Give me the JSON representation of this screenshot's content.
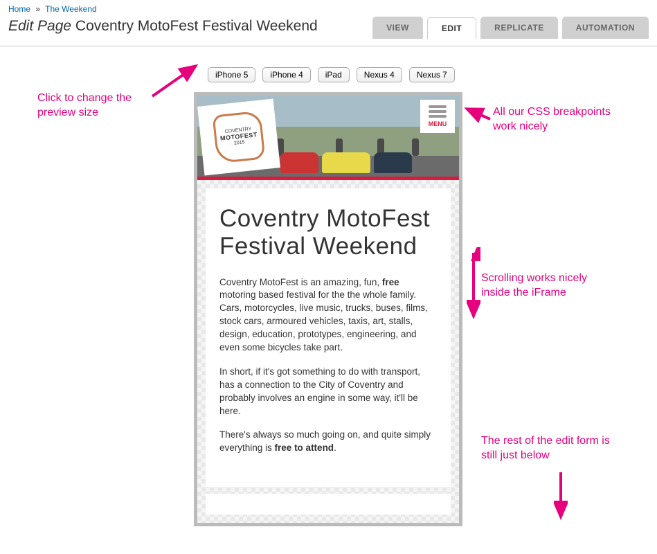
{
  "breadcrumb": {
    "home": "Home",
    "weekend": "The Weekend"
  },
  "page_title_prefix": "Edit Page",
  "page_title": "Coventry MotoFest Festival Weekend",
  "tabs": {
    "view": "VIEW",
    "edit": "EDIT",
    "replicate": "REPLICATE",
    "automation": "AUTOMATION"
  },
  "devices": {
    "iphone5": "iPhone 5",
    "iphone4": "iPhone 4",
    "ipad": "iPad",
    "nexus4": "Nexus 4",
    "nexus7": "Nexus 7"
  },
  "logo": {
    "small": "COVENTRY",
    "big": "MOTOFEST",
    "year": "2015"
  },
  "menu_label": "MENU",
  "content": {
    "title": "Coventry MotoFest Festival Weekend",
    "p1a": "Coventry MotoFest is an amazing, fun, ",
    "p1b": "free",
    "p1c": " motoring based festival for the the whole family. Cars, motorcycles, live music, trucks, buses, films, stock cars, armoured vehicles, taxis, art, stalls, design, education, prototypes, engineering, and even some bicycles take part.",
    "p2": "In short, if it's got something to do with transport, has a connection to the City of Coventry and probably involves an engine in some way, it'll be here.",
    "p3a": "There's always so much going on, and quite simply everything is ",
    "p3b": "free to attend",
    "p3c": "."
  },
  "annotations": {
    "a1": "Click to change the preview size",
    "a2": "All our CSS breakpoints work nicely",
    "a3": "Scrolling works nicely inside the iFrame",
    "a4": "The rest of the edit form is still just below"
  }
}
